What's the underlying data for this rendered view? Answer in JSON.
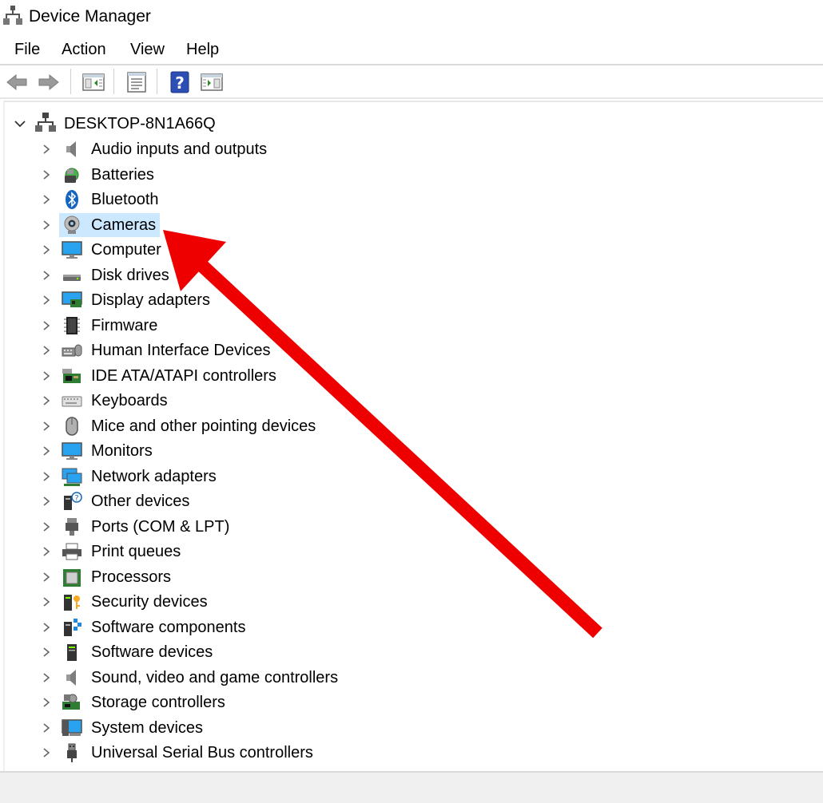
{
  "window": {
    "title": "Device Manager"
  },
  "menu": {
    "items": [
      "File",
      "Action",
      "View",
      "Help"
    ]
  },
  "toolbar": {
    "buttons": [
      "back-icon",
      "forward-icon",
      "show-hide-console-tree-icon",
      "properties-icon",
      "help-icon",
      "action-pane-icon"
    ]
  },
  "tree": {
    "root": "DESKTOP-8N1A66Q",
    "items": [
      {
        "label": "Audio inputs and outputs",
        "icon": "speaker-icon"
      },
      {
        "label": "Batteries",
        "icon": "battery-icon"
      },
      {
        "label": "Bluetooth",
        "icon": "bluetooth-icon"
      },
      {
        "label": "Cameras",
        "icon": "webcam-icon"
      },
      {
        "label": "Computer",
        "icon": "monitor-icon"
      },
      {
        "label": "Disk drives",
        "icon": "disk-drive-icon"
      },
      {
        "label": "Display adapters",
        "icon": "display-adapter-icon"
      },
      {
        "label": "Firmware",
        "icon": "chip-icon"
      },
      {
        "label": "Human Interface Devices",
        "icon": "hid-icon"
      },
      {
        "label": "IDE ATA/ATAPI controllers",
        "icon": "ide-controller-icon"
      },
      {
        "label": "Keyboards",
        "icon": "keyboard-icon"
      },
      {
        "label": "Mice and other pointing devices",
        "icon": "mouse-icon"
      },
      {
        "label": "Monitors",
        "icon": "monitor-icon"
      },
      {
        "label": "Network adapters",
        "icon": "network-adapter-icon"
      },
      {
        "label": "Other devices",
        "icon": "unknown-device-icon"
      },
      {
        "label": "Ports (COM & LPT)",
        "icon": "port-icon"
      },
      {
        "label": "Print queues",
        "icon": "printer-icon"
      },
      {
        "label": "Processors",
        "icon": "processor-icon"
      },
      {
        "label": "Security devices",
        "icon": "security-key-icon"
      },
      {
        "label": "Software components",
        "icon": "software-component-icon"
      },
      {
        "label": "Software devices",
        "icon": "software-device-icon"
      },
      {
        "label": "Sound, video and game controllers",
        "icon": "speaker-icon"
      },
      {
        "label": "Storage controllers",
        "icon": "storage-controller-icon"
      },
      {
        "label": "System devices",
        "icon": "system-device-icon"
      },
      {
        "label": "Universal Serial Bus controllers",
        "icon": "usb-icon"
      }
    ],
    "selected_index": 3
  },
  "annotation": {
    "arrow_color": "#ee0000",
    "points_to": "Cameras"
  },
  "colors": {
    "selection": "#cce8ff",
    "accent": "#0063b1"
  }
}
